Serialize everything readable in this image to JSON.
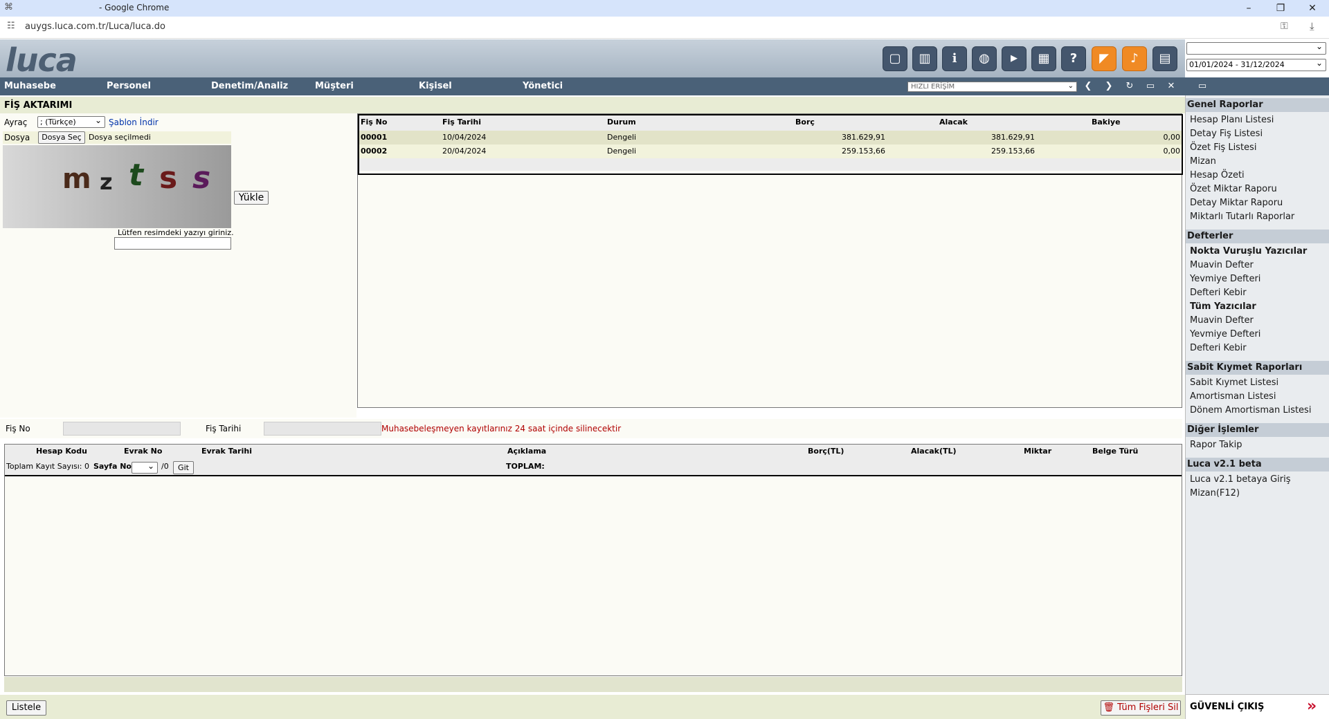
{
  "browser": {
    "title": "- Google Chrome",
    "url": "auygs.luca.com.tr/Luca/luca.do",
    "min": "–",
    "restore": "❐",
    "close": "✕"
  },
  "app": {
    "logo": "luca",
    "date_range": "01/01/2024 - 31/12/2024",
    "top_select": "",
    "toolbar_icons": [
      "note-icon",
      "book-icon",
      "info-icon",
      "globe-icon",
      "youtube-icon",
      "calculator-icon",
      "help-icon",
      "megaphone-icon",
      "bell-icon",
      "notebook-icon"
    ]
  },
  "menu": {
    "items": [
      "Muhasebe",
      "Personel",
      "Denetim/Analiz",
      "Müşteri",
      "Kişisel",
      "Yönetici"
    ],
    "quick_access": "HIZLI ERİŞİM"
  },
  "page": {
    "title": "FİŞ AKTARIMI",
    "separator_label": "Ayraç",
    "separator_value": "; (Türkçe)",
    "template_link": "Şablon İndir",
    "file_label": "Dosya",
    "file_button": "Dosya Seç",
    "file_status": "Dosya seçilmedi",
    "captcha_chars": [
      "m",
      "z",
      "t",
      "s",
      "s"
    ],
    "captcha_prompt": "Lütfen resimdeki yazıyı giriniz.",
    "upload_button": "Yükle"
  },
  "grid": {
    "headers": [
      "Fiş No",
      "Fiş Tarihi",
      "Durum",
      "Borç",
      "Alacak",
      "Bakiye"
    ],
    "rows": [
      [
        "00001",
        "10/04/2024",
        "Dengeli",
        "381.629,91",
        "381.629,91",
        "0,00"
      ],
      [
        "00002",
        "20/04/2024",
        "Dengeli",
        "259.153,66",
        "259.153,66",
        "0,00"
      ]
    ]
  },
  "filter": {
    "fis_no_label": "Fiş No",
    "fis_tarihi_label": "Fiş Tarihi",
    "warning": "Muhasebeleşmeyen kayıtlarınız 24 saat içinde silinecektir"
  },
  "detail": {
    "headers": [
      "Hesap Kodu",
      "Evrak No",
      "Evrak Tarihi",
      "Açıklama",
      "Borç(TL)",
      "Alacak(TL)",
      "Miktar",
      "Belge Türü"
    ],
    "total_records_label": "Toplam Kayıt Sayısı: 0",
    "page_label": "Sayfa No:",
    "page_total": "/0",
    "go_button": "Git",
    "total_label": "TOPLAM:"
  },
  "bottom": {
    "list_button": "Listele",
    "delete_all_button": "Tüm Fişleri Sil"
  },
  "sidebar": {
    "sections": [
      {
        "title": "Genel Raporlar",
        "items": [
          {
            "label": "Hesap Planı Listesi"
          },
          {
            "label": "Detay Fiş Listesi"
          },
          {
            "label": "Özet Fiş Listesi"
          },
          {
            "label": "Mizan"
          },
          {
            "label": "Hesap Özeti"
          },
          {
            "label": "Özet Miktar Raporu"
          },
          {
            "label": "Detay Miktar Raporu"
          },
          {
            "label": "Miktarlı Tutarlı Raporlar"
          }
        ]
      },
      {
        "title": "Defterler",
        "items": [
          {
            "label": "Nokta Vuruşlu Yazıcılar",
            "bold": true
          },
          {
            "label": "Muavin Defter"
          },
          {
            "label": "Yevmiye Defteri"
          },
          {
            "label": "Defteri Kebir"
          },
          {
            "label": "Tüm Yazıcılar",
            "bold": true
          },
          {
            "label": "Muavin Defter"
          },
          {
            "label": "Yevmiye Defteri"
          },
          {
            "label": "Defteri Kebir"
          }
        ]
      },
      {
        "title": "Sabit Kıymet Raporları",
        "items": [
          {
            "label": "Sabit Kıymet Listesi"
          },
          {
            "label": "Amortisman Listesi"
          },
          {
            "label": "Dönem Amortisman Listesi"
          }
        ]
      },
      {
        "title": "Diğer İşlemler",
        "items": [
          {
            "label": "Rapor Takip"
          }
        ]
      },
      {
        "title": "Luca v2.1 beta",
        "items": [
          {
            "label": "Luca v2.1 betaya Giriş"
          },
          {
            "label": "Mizan(F12)"
          }
        ]
      }
    ],
    "logout": "GÜVENLİ ÇIKIŞ"
  },
  "colors": {
    "accent": "#4a6178",
    "warning": "#b00000",
    "orange": "#f08a24"
  }
}
